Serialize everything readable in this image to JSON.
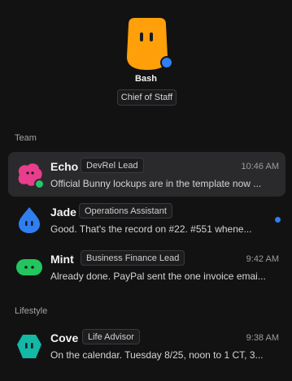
{
  "profile": {
    "name": "Bash",
    "role": "Chief of Staff",
    "avatar_icon": "bash-mascot-icon",
    "avatar_color": "#ff9f0a",
    "online_color": "#2f7ff0"
  },
  "sections": {
    "team": "Team",
    "lifestyle": "Lifestyle"
  },
  "conversations": [
    {
      "name": "Echo",
      "role": "DevRel Lead",
      "time": "10:46 AM",
      "preview": "Official Bunny lockups are in the template now ...",
      "avatar_icon": "echo-mascot-icon",
      "avatar_color": "#e83e8c",
      "active": true,
      "online": true
    },
    {
      "name": "Jade",
      "role": "Operations Assistant",
      "time": "",
      "preview": "Good. That's the record on #22. #551 whene...",
      "avatar_icon": "jade-mascot-icon",
      "avatar_color": "#2f7ff0",
      "unread": true
    },
    {
      "name": "Mint",
      "role": "Business Finance Lead",
      "time": "9:42 AM",
      "preview": "Already done. PayPal sent the one invoice emai...",
      "avatar_icon": "mint-mascot-icon",
      "avatar_color": "#22c55e"
    },
    {
      "name": "Cove",
      "role": "Life Advisor",
      "time": "9:38 AM",
      "preview": "On the calendar. Tuesday 8/25, noon to 1 CT, 3...",
      "avatar_icon": "cove-mascot-icon",
      "avatar_color": "#14b8a6"
    }
  ]
}
